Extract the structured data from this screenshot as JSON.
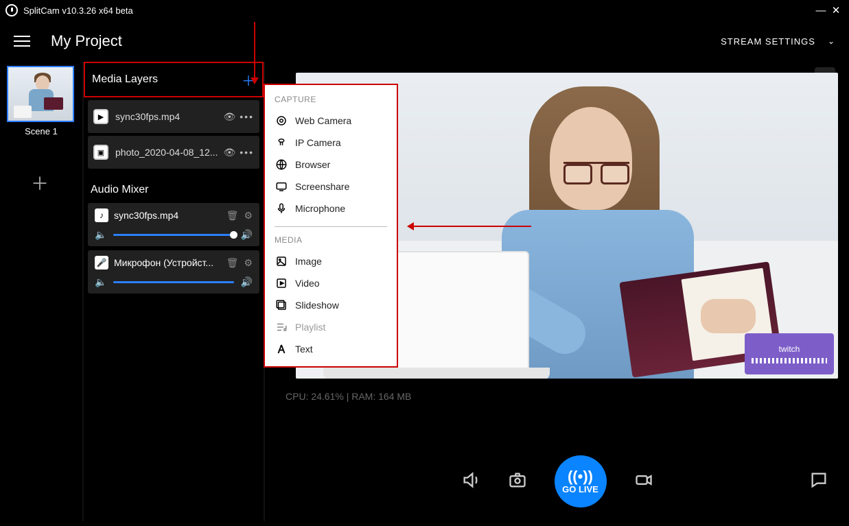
{
  "window": {
    "title": "SplitCam v10.3.26 x64 beta"
  },
  "project": {
    "title": "My Project"
  },
  "stream_settings_label": "STREAM SETTINGS",
  "scene": {
    "label": "Scene 1"
  },
  "media_layers": {
    "header": "Media Layers",
    "items": [
      {
        "name": "sync30fps.mp4",
        "icon": "▶"
      },
      {
        "name": "photo_2020-04-08_12...",
        "icon": "▣"
      }
    ]
  },
  "audio_mixer": {
    "title": "Audio Mixer",
    "items": [
      {
        "name": "sync30fps.mp4",
        "icon": "♪"
      },
      {
        "name": "Микрофон (Устройст...",
        "icon": "🎤"
      }
    ]
  },
  "stats": "CPU: 24.61% | RAM: 164 MB",
  "golive_label": "GO LIVE",
  "twitch_badge": "twitch",
  "popup": {
    "capture_label": "CAPTURE",
    "media_label": "MEDIA",
    "capture_items": [
      {
        "label": "Web Camera",
        "key": "webcam"
      },
      {
        "label": "IP Camera",
        "key": "ipcam"
      },
      {
        "label": "Browser",
        "key": "browser"
      },
      {
        "label": "Screenshare",
        "key": "screenshare"
      },
      {
        "label": "Microphone",
        "key": "microphone"
      }
    ],
    "media_items": [
      {
        "label": "Image",
        "key": "image",
        "disabled": false
      },
      {
        "label": "Video",
        "key": "video",
        "disabled": false
      },
      {
        "label": "Slideshow",
        "key": "slideshow",
        "disabled": false
      },
      {
        "label": "Playlist",
        "key": "playlist",
        "disabled": true
      },
      {
        "label": "Text",
        "key": "text",
        "disabled": false
      }
    ]
  }
}
